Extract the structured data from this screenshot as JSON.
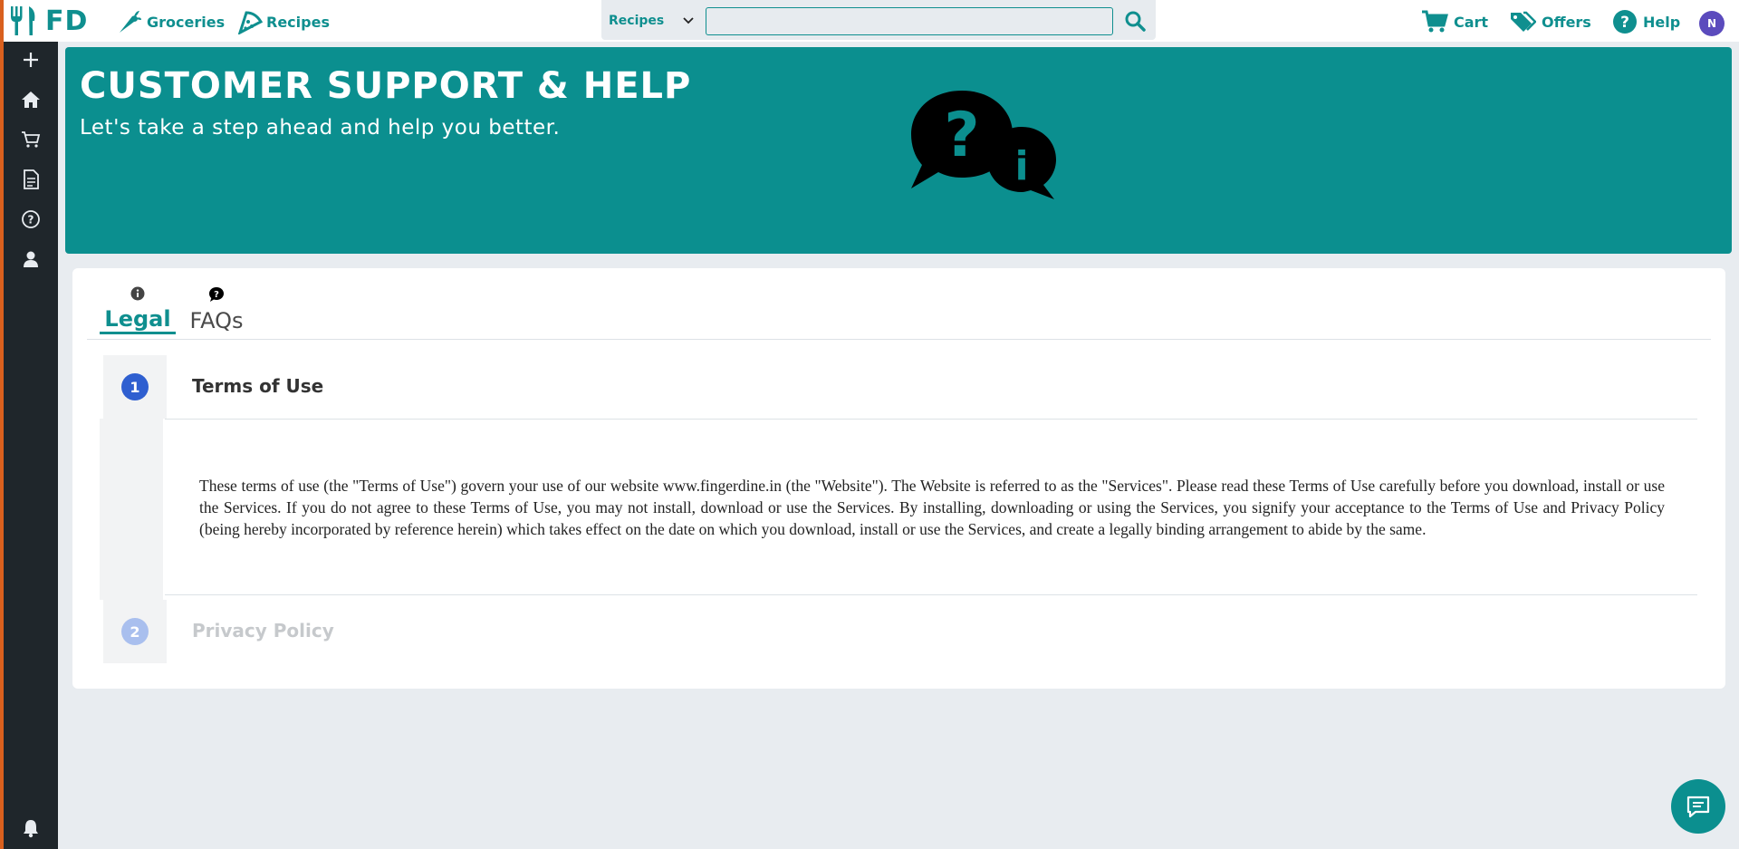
{
  "app": {
    "logo_text": "FD",
    "colors": {
      "brand": "#0f8f8f",
      "banner": "#0b8f8f",
      "sidebar": "#1f262b",
      "step_active": "#2f5fd0",
      "step_inactive": "#a9bfee",
      "avatar": "#5b4bbd"
    }
  },
  "topnav": {
    "groceries_label": "Groceries",
    "recipes_label": "Recipes",
    "search": {
      "category": "Recipes",
      "placeholder": "",
      "value": ""
    },
    "cart_label": "Cart",
    "offers_label": "Offers",
    "help_label": "Help",
    "avatar_initial": "N"
  },
  "sidebar": {
    "items": [
      {
        "icon": "plus-icon"
      },
      {
        "icon": "home-icon"
      },
      {
        "icon": "cart-icon"
      },
      {
        "icon": "document-icon"
      },
      {
        "icon": "help-circle-icon"
      },
      {
        "icon": "user-icon"
      },
      {
        "icon": "bell-icon"
      }
    ]
  },
  "banner": {
    "title": "CUSTOMER SUPPORT & HELP",
    "subtitle": "Let's take a step ahead and help you better."
  },
  "tabs": [
    {
      "label": "Legal",
      "icon": "info-icon",
      "active": true
    },
    {
      "label": "FAQs",
      "icon": "question-bubble-icon",
      "active": false
    }
  ],
  "steps": [
    {
      "number": "1",
      "title": "Terms of Use",
      "body": "These terms of use (the \"Terms of Use\") govern your use of our website www.fingerdine.in (the \"Website\"). The Website is  referred to as the \"Services\". Please read these Terms of Use carefully before you download, install or use the Services. If you do not agree to these Terms of Use, you may not install, download or use the Services. By installing, downloading or using the Services, you signify your acceptance to the Terms of Use and Privacy Policy (being hereby incorporated by reference herein) which takes effect on the date on which you download, install or use the Services, and create a legally binding arrangement to abide by the same."
    },
    {
      "number": "2",
      "title": "Privacy Policy"
    }
  ]
}
